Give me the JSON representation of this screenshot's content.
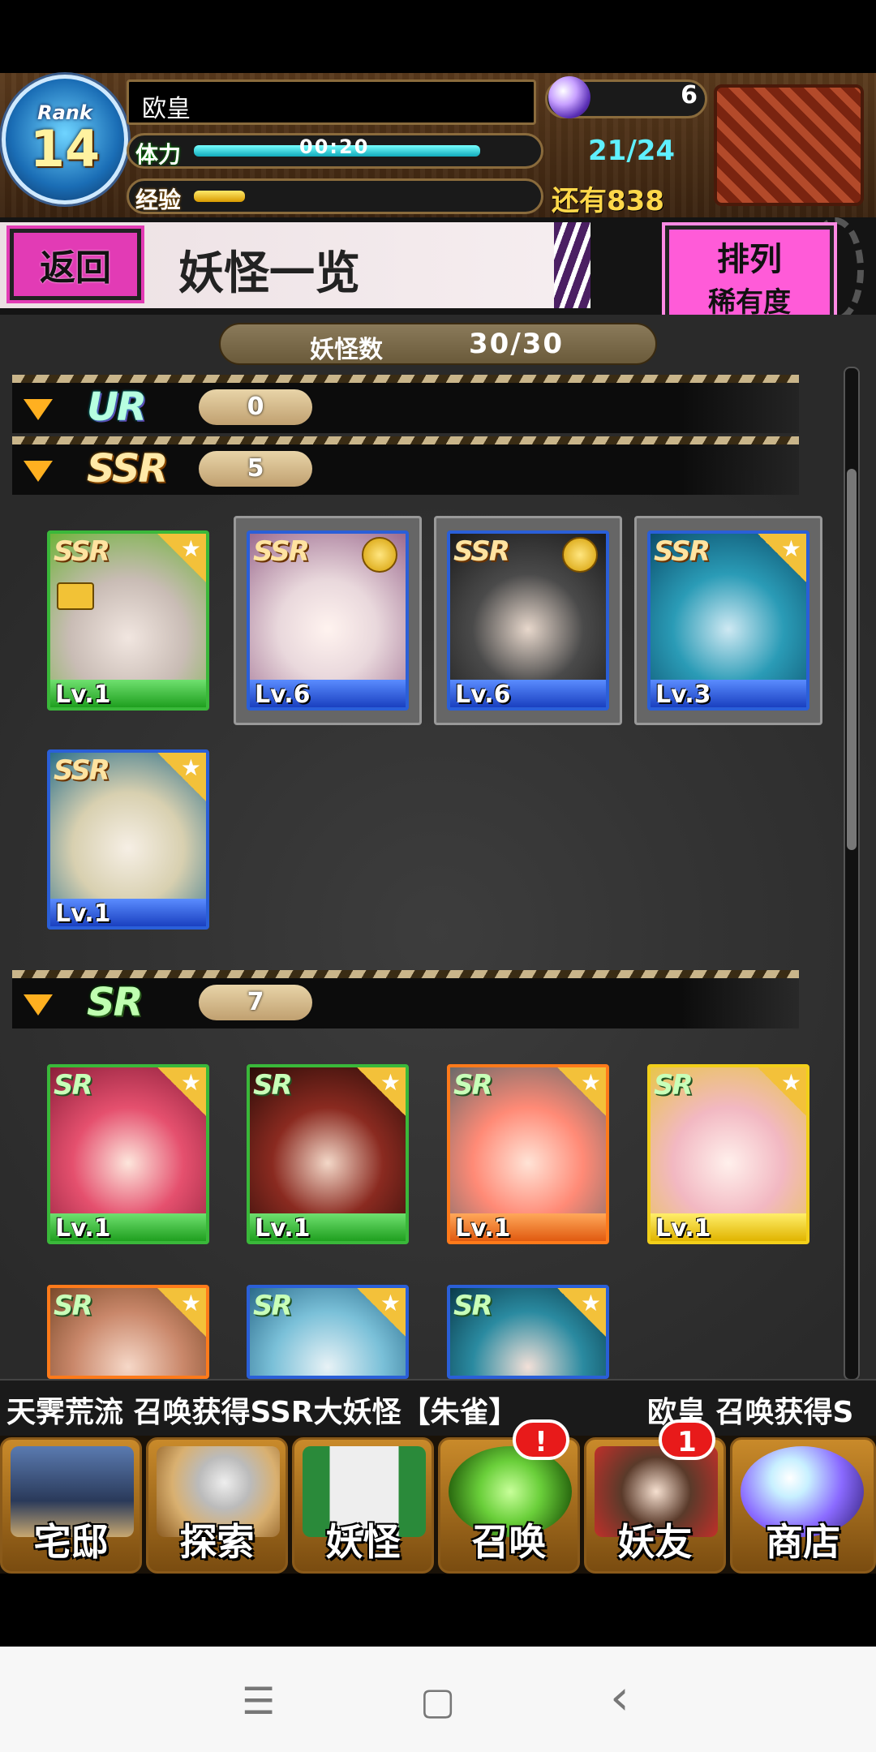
{
  "header": {
    "rank_label": "Rank",
    "rank_value": "14",
    "player_name": "欧皇",
    "stamina_label": "体力",
    "stamina_timer": "00:20",
    "stamina_fill": 0.84,
    "exp_label": "经验",
    "exp_fill": 0.15,
    "orb_count": "6",
    "stamina_count": "21/24",
    "exp_remaining": "还有838"
  },
  "subheader": {
    "back_label": "返回",
    "title": "妖怪一览",
    "sort_line1": "排列",
    "sort_line2": "稀有度"
  },
  "summary": {
    "count_label": "妖怪数",
    "count_value": "30/30"
  },
  "sections": [
    {
      "rarity": "UR",
      "count": "0"
    },
    {
      "rarity": "SSR",
      "count": "5"
    },
    {
      "rarity": "SR",
      "count": "7"
    }
  ],
  "ssr_cards": [
    {
      "badge": "SSR",
      "level": "Lv.1"
    },
    {
      "badge": "SSR",
      "level": "Lv.6"
    },
    {
      "badge": "SSR",
      "level": "Lv.6"
    },
    {
      "badge": "SSR",
      "level": "Lv.3"
    },
    {
      "badge": "SSR",
      "level": "Lv.1"
    }
  ],
  "sr_cards": [
    {
      "badge": "SR",
      "level": "Lv.1"
    },
    {
      "badge": "SR",
      "level": "Lv.1"
    },
    {
      "badge": "SR",
      "level": "Lv.1"
    },
    {
      "badge": "SR",
      "level": "Lv.1"
    },
    {
      "badge": "SR",
      "level": ""
    },
    {
      "badge": "SR",
      "level": ""
    },
    {
      "badge": "SR",
      "level": ""
    }
  ],
  "ticker": {
    "message1": "天霁荒流 召唤获得SSR大妖怪【朱雀】",
    "message2": "欧皇 召唤获得S"
  },
  "nav": {
    "home": "宅邸",
    "explore": "探索",
    "yokai": "妖怪",
    "summon": "召唤",
    "summon_alert": "!",
    "friends": "妖友",
    "friends_alert": "1",
    "shop": "商店"
  },
  "star_glyph": "★",
  "system_nav": {
    "menu": "☰",
    "home": "▢",
    "back": "‹"
  }
}
